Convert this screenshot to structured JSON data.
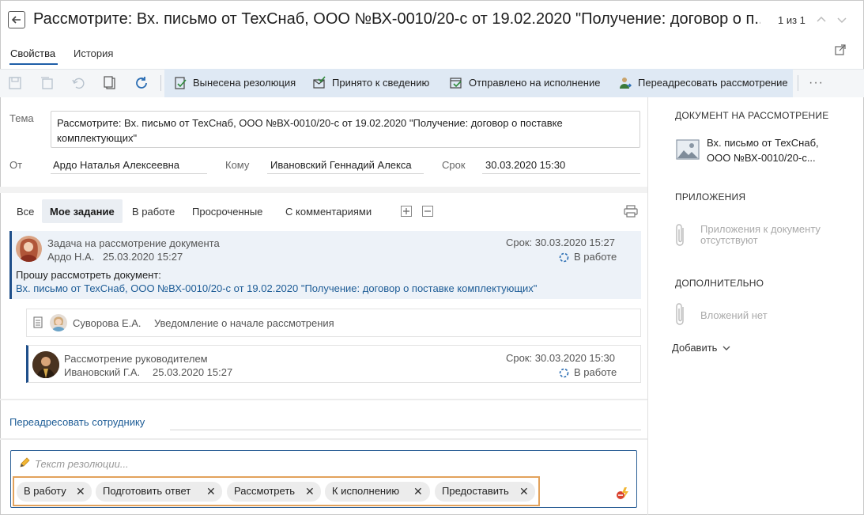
{
  "header": {
    "title": "Рассмотрите: Вх. письмо от ТехСнаб, ООО №ВХ-0010/20-с от 19.02.2020 \"Получение: договор о п...",
    "pager": "1 из 1"
  },
  "tabs": [
    "Свойства",
    "История"
  ],
  "toolbar": {
    "actions": [
      "Вынесена резолюция",
      "Принято к сведению",
      "Отправлено на исполнение",
      "Переадресовать рассмотрение"
    ],
    "more": "···"
  },
  "form": {
    "subject_label": "Тема",
    "subject_value": "Рассмотрите: Вх. письмо от ТехСнаб, ООО №ВХ-0010/20-с от 19.02.2020 \"Получение: договор о поставке комплектующих\"",
    "from_label": "От",
    "from_value": "Ардо Наталья Алексеевна",
    "to_label": "Кому",
    "to_value": "Ивановский Геннадий Алекса",
    "deadline_label": "Срок",
    "deadline_value": "30.03.2020 15:30"
  },
  "filters": [
    "Все",
    "Мое задание",
    "В работе",
    "Просроченные",
    "С комментариями"
  ],
  "tasks": [
    {
      "title": "Задача на рассмотрение документа",
      "author": "Ардо Н.А.",
      "date": "25.03.2020 15:27",
      "deadline": "Срок: 30.03.2020 15:27",
      "status": "В работе",
      "body": "Прошу рассмотреть документ:",
      "link": "Вх. письмо от ТехСнаб, ООО №ВХ-0010/20-с от 19.02.2020 \"Получение: договор о поставке комплектующих\""
    },
    {
      "author": "Суворова Е.А.",
      "title": "Уведомление о начале рассмотрения"
    },
    {
      "title": "Рассмотрение руководителем",
      "author": "Ивановский Г.А.",
      "date": "25.03.2020 15:27",
      "deadline": "Срок: 30.03.2020 15:30",
      "status": "В работе"
    }
  ],
  "redirect_link": "Переадресовать сотруднику",
  "resolution": {
    "placeholder": "Текст резолюции...",
    "chips": [
      "В работу",
      "Подготовить ответ",
      "Рассмотреть",
      "К исполнению",
      "Предоставить"
    ]
  },
  "right_panel": {
    "doc_heading": "ДОКУМЕНТ НА РАССМОТРЕНИЕ",
    "doc_line1": "Вх. письмо от ТехСнаб,",
    "doc_line2": "ООО №ВХ-0010/20-с...",
    "attachments_heading": "ПРИЛОЖЕНИЯ",
    "attachments_line1": "Приложения к документу",
    "attachments_line2": "отсутствуют",
    "extra_heading": "ДОПОЛНИТЕЛЬНО",
    "extra_empty": "Вложений нет",
    "add_label": "Добавить"
  },
  "colors": {
    "accent": "#1f4f8a",
    "link": "#1d5c96",
    "chip_highlight": "#e2a25c",
    "action_bar": "#dfe9f4"
  }
}
